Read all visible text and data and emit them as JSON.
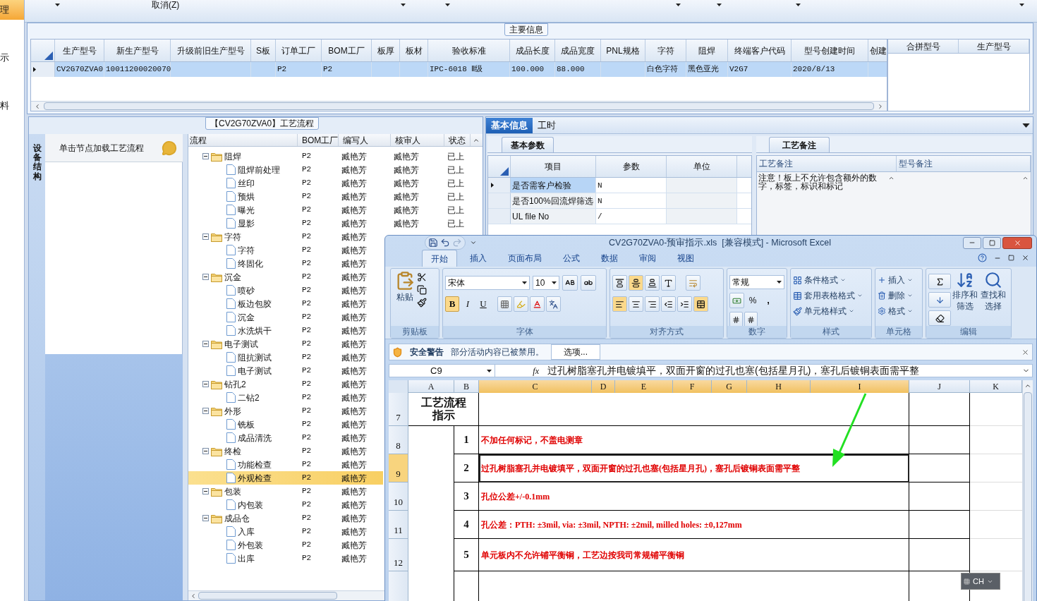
{
  "left_nav": [
    {
      "label": "理",
      "selected": true
    },
    {
      "label": "示",
      "selected": false
    },
    {
      "label": "料",
      "selected": false
    }
  ],
  "toolbar": {
    "cancel": "取消(Z)"
  },
  "main_info": {
    "title": "主要信息",
    "columns": [
      "生产型号",
      "新生产型号",
      "升级前旧生产型号",
      "S板",
      "订单工厂",
      "BOM工厂",
      "板厚",
      "板材",
      "验收标准",
      "成品长度",
      "成品宽度",
      "PNL规格",
      "字符",
      "阻焊",
      "终端客户代码",
      "型号创建时间",
      "创建"
    ],
    "rows": [
      {
        "selected": true,
        "cells": [
          "CV2G70ZVA0",
          "10011200020070",
          null,
          null,
          "P2",
          "P2",
          null,
          null,
          "IPC-6018 Ⅱ级",
          "100.000",
          "88.000",
          null,
          "白色字符",
          "黑色亚光",
          "V2G7",
          "2020/8/13",
          null
        ]
      }
    ]
  },
  "merge_grid": {
    "columns": [
      "合拼型号",
      "生产型号"
    ]
  },
  "process": {
    "title": "【CV2G70ZVA0】工艺流程",
    "side_tab": "设备结构",
    "hint": "单击节点加载工艺流程",
    "columns": [
      "流程",
      "BOM工厂",
      "编写人",
      "核审人",
      "状态"
    ],
    "tree": [
      {
        "name": "阻焊",
        "bom": "P2",
        "writer": "臧艳芳",
        "reviewer": "臧艳芳",
        "status": "已上",
        "selected": false,
        "expanded": true,
        "children": [
          {
            "name": "阻焊前处理",
            "bom": "P2",
            "writer": "臧艳芳",
            "reviewer": "臧艳芳",
            "status": "已上",
            "selected": false
          },
          {
            "name": "丝印",
            "bom": "P2",
            "writer": "臧艳芳",
            "reviewer": "臧艳芳",
            "status": "已上",
            "selected": false
          },
          {
            "name": "预烘",
            "bom": "P2",
            "writer": "臧艳芳",
            "reviewer": "臧艳芳",
            "status": "已上",
            "selected": false
          },
          {
            "name": "曝光",
            "bom": "P2",
            "writer": "臧艳芳",
            "reviewer": "臧艳芳",
            "status": "已上",
            "selected": false
          },
          {
            "name": "显影",
            "bom": "P2",
            "writer": "臧艳芳",
            "reviewer": "臧艳芳",
            "status": "已上",
            "selected": false
          }
        ]
      },
      {
        "name": "字符",
        "bom": "P2",
        "writer": "臧艳芳",
        "selected": false,
        "expanded": true,
        "children": [
          {
            "name": "字符",
            "bom": "P2",
            "writer": "臧艳芳",
            "selected": false
          },
          {
            "name": "终固化",
            "bom": "P2",
            "writer": "臧艳芳",
            "selected": false
          }
        ]
      },
      {
        "name": "沉金",
        "bom": "P2",
        "writer": "臧艳芳",
        "selected": false,
        "expanded": true,
        "children": [
          {
            "name": "喷砂",
            "bom": "P2",
            "writer": "臧艳芳",
            "selected": false
          },
          {
            "name": "板边包胶",
            "bom": "P2",
            "writer": "臧艳芳",
            "selected": false
          },
          {
            "name": "沉金",
            "bom": "P2",
            "writer": "臧艳芳",
            "selected": false
          },
          {
            "name": "水洗烘干",
            "bom": "P2",
            "writer": "臧艳芳",
            "selected": false
          }
        ]
      },
      {
        "name": "电子测试",
        "bom": "P2",
        "writer": "臧艳芳",
        "selected": false,
        "expanded": true,
        "children": [
          {
            "name": "阻抗测试",
            "bom": "P2",
            "writer": "臧艳芳",
            "selected": false
          },
          {
            "name": "电子测试",
            "bom": "P2",
            "writer": "臧艳芳",
            "selected": false
          }
        ]
      },
      {
        "name": "钻孔2",
        "bom": "P2",
        "writer": "臧艳芳",
        "selected": false,
        "expanded": true,
        "children": [
          {
            "name": "二钻2",
            "bom": "P2",
            "writer": "臧艳芳",
            "selected": false
          }
        ]
      },
      {
        "name": "外形",
        "bom": "P2",
        "writer": "臧艳芳",
        "selected": false,
        "expanded": true,
        "children": [
          {
            "name": "铣板",
            "bom": "P2",
            "writer": "臧艳芳",
            "selected": false
          },
          {
            "name": "成品清洗",
            "bom": "P2",
            "writer": "臧艳芳",
            "selected": false
          }
        ]
      },
      {
        "name": "终检",
        "bom": "P2",
        "writer": "臧艳芳",
        "selected": false,
        "expanded": true,
        "children": [
          {
            "name": "功能检查",
            "bom": "P2",
            "writer": "臧艳芳",
            "selected": false
          },
          {
            "name": "外观检查",
            "bom": "P2",
            "writer": "臧艳芳",
            "selected": true
          }
        ]
      },
      {
        "name": "包装",
        "bom": "P2",
        "writer": "臧艳芳",
        "selected": false,
        "expanded": true,
        "children": [
          {
            "name": "内包装",
            "bom": "P2",
            "writer": "臧艳芳",
            "selected": false
          }
        ]
      },
      {
        "name": "成品仓",
        "bom": "P2",
        "writer": "臧艳芳",
        "selected": false,
        "expanded": true,
        "children": [
          {
            "name": "入库",
            "bom": "P2",
            "writer": "臧艳芳",
            "selected": false
          },
          {
            "name": "外包装",
            "bom": "P2",
            "writer": "臧艳芳",
            "selected": false
          },
          {
            "name": "出库",
            "bom": "P2",
            "writer": "臧艳芳",
            "selected": false
          }
        ]
      }
    ]
  },
  "detail": {
    "tabs": [
      {
        "label": "基本信息",
        "selected": true
      },
      {
        "label": "工时",
        "selected": false
      }
    ],
    "params": {
      "tab": "基本参数",
      "columns": [
        "项目",
        "参数",
        "单位"
      ],
      "rows": [
        {
          "item": "是否需客户检验",
          "value": "N",
          "selected": true
        },
        {
          "item": "是否100%回流焊筛选",
          "value": "N",
          "selected": false
        },
        {
          "item": "UL file No",
          "value": "/",
          "selected": false
        }
      ]
    },
    "notes": {
      "tab": "工艺备注",
      "columns": [
        "工艺备注",
        "型号备注"
      ],
      "text": "注意！板上不允许包含额外的数字，标签，标识和标记"
    }
  },
  "excel": {
    "title": "CV2G70ZVA0-预审指示.xls  [兼容模式] - Microsoft Excel",
    "tabs": [
      {
        "label": "开始",
        "selected": true
      },
      {
        "label": "插入",
        "selected": false
      },
      {
        "label": "页面布局",
        "selected": false
      },
      {
        "label": "公式",
        "selected": false
      },
      {
        "label": "数据",
        "selected": false
      },
      {
        "label": "审阅",
        "selected": false
      },
      {
        "label": "视图",
        "selected": false
      }
    ],
    "ribbon": {
      "clipboard": {
        "label": "剪贴板",
        "paste": "粘贴"
      },
      "font": {
        "label": "字体",
        "name": "宋体",
        "size": "10",
        "bold": "B",
        "italic": "I",
        "underline": "U"
      },
      "alignment": {
        "label": "对齐方式"
      },
      "number": {
        "label": "数字",
        "format": "常规",
        "percent": "%",
        "comma": ","
      },
      "styles": {
        "label": "样式",
        "items": [
          "条件格式",
          "套用表格格式",
          "单元格样式"
        ]
      },
      "cells": {
        "label": "单元格",
        "items": [
          "插入",
          "删除",
          "格式"
        ]
      },
      "editing": {
        "label": "编辑",
        "items": [
          "排序和筛选",
          "查找和选择"
        ]
      }
    },
    "security": {
      "title": "安全警告",
      "message": "部分活动内容已被禁用。",
      "button": "选项..."
    },
    "name_box": "C9",
    "formula_label": "fx",
    "formula": "过孔树脂塞孔并电镀填平，双面开窗的过孔也塞(包括星月孔)，塞孔后镀铜表面需平整",
    "columns": [
      {
        "label": "A",
        "selected": false
      },
      {
        "label": "B",
        "selected": false
      },
      {
        "label": "C",
        "selected": true
      },
      {
        "label": "D",
        "selected": true
      },
      {
        "label": "E",
        "selected": true
      },
      {
        "label": "F",
        "selected": true
      },
      {
        "label": "G",
        "selected": true
      },
      {
        "label": "H",
        "selected": true
      },
      {
        "label": "I",
        "selected": true
      },
      {
        "label": "J",
        "selected": false
      },
      {
        "label": "K",
        "selected": false
      }
    ],
    "rows": [
      {
        "number": "7",
        "selected": false,
        "label": "工艺流程指示"
      },
      {
        "number": "8",
        "selected": false,
        "step": "1",
        "text": "不加任何标记，不盖电测章"
      },
      {
        "number": "9",
        "selected": true,
        "step": "2",
        "text": "过孔树脂塞孔并电镀填平，双面开窗的过孔也塞(包括星月孔)，塞孔后镀铜表面需平整"
      },
      {
        "number": "10",
        "selected": false,
        "step": "3",
        "text": "孔位公差+/-0.1mm"
      },
      {
        "number": "11",
        "selected": false,
        "step": "4",
        "text": "孔公差：PTH: ±3mil, via: ±3mil, NPTH: ±2mil, milled holes: ±0,127mm"
      },
      {
        "number": "12",
        "selected": false,
        "step": "5",
        "text": "单元板内不允许铺平衡铜，工艺边按我司常规铺平衡铜"
      }
    ],
    "language_bar": "CH"
  }
}
